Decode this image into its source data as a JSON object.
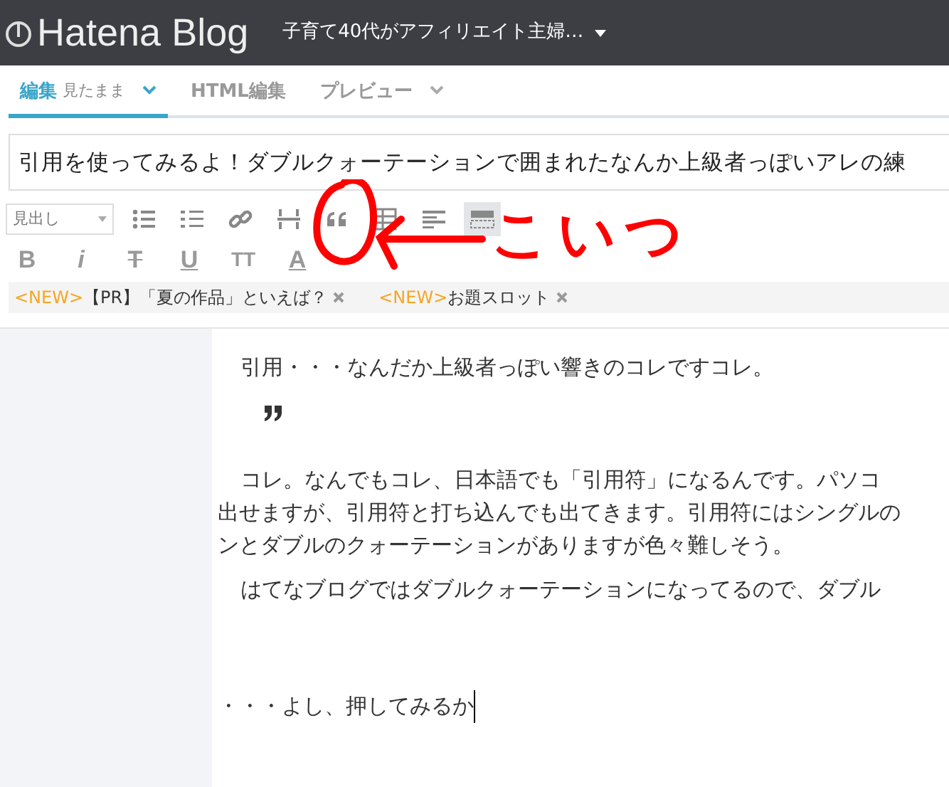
{
  "header": {
    "logo": "Hatena Blog",
    "blog_name": "子育て40代がアフィリエイト主婦…"
  },
  "tabs": [
    {
      "label": "編集",
      "sub": "見たまま",
      "dropdown": true,
      "selected": true
    },
    {
      "label": "HTML編集",
      "dropdown": false,
      "selected": false
    },
    {
      "label": "プレビュー",
      "dropdown": true,
      "selected": false
    }
  ],
  "title_field": {
    "value": "引用を使ってみるよ！ダブルクォーテーションで囲まれたなんか上級者っぽいアレの練"
  },
  "toolbar": {
    "heading_select": "見出し",
    "icons": [
      {
        "kind": "list",
        "selected": false
      },
      {
        "kind": "numbered",
        "selected": false
      },
      {
        "kind": "link",
        "selected": false
      },
      {
        "kind": "more",
        "selected": false
      },
      {
        "kind": "quote",
        "selected": false
      },
      {
        "kind": "table",
        "selected": false
      },
      {
        "kind": "align",
        "selected": false
      },
      {
        "kind": "panel",
        "selected": true
      }
    ],
    "format": [
      {
        "kind": "bold",
        "label": "B"
      },
      {
        "kind": "italic",
        "label": "i"
      },
      {
        "kind": "strike",
        "label": "T"
      },
      {
        "kind": "underline",
        "label": "U"
      },
      {
        "kind": "size",
        "label": "TT"
      },
      {
        "kind": "color",
        "label": "A"
      }
    ]
  },
  "annotation": {
    "text": "こいつ"
  },
  "tags": [
    {
      "badge": "<NEW>",
      "text": "【PR】「夏の作品」といえば？"
    },
    {
      "badge": "<NEW>",
      "text": "お題スロット"
    }
  ],
  "body": [
    {
      "kind": "para",
      "lines": [
        "引用・・・なんだか上級者っぽい響きのコレですコレ。"
      ]
    },
    {
      "kind": "quote"
    },
    {
      "kind": "para",
      "lines": [
        "コレ。なんでもコレ、日本語でも「引用符」になるんです。パソコ",
        "出せますが、引用符と打ち込んでも出てきます。引用符にはシングルの",
        "ンとダブルのクォーテーションがありますが色々難しそう。"
      ]
    },
    {
      "kind": "para",
      "lines": [
        "はてなブログではダブルクォーテーションになってるので、ダブル"
      ]
    },
    {
      "kind": "gap"
    },
    {
      "kind": "cursor",
      "lines": [
        "・・・よし、押してみるか"
      ]
    }
  ]
}
